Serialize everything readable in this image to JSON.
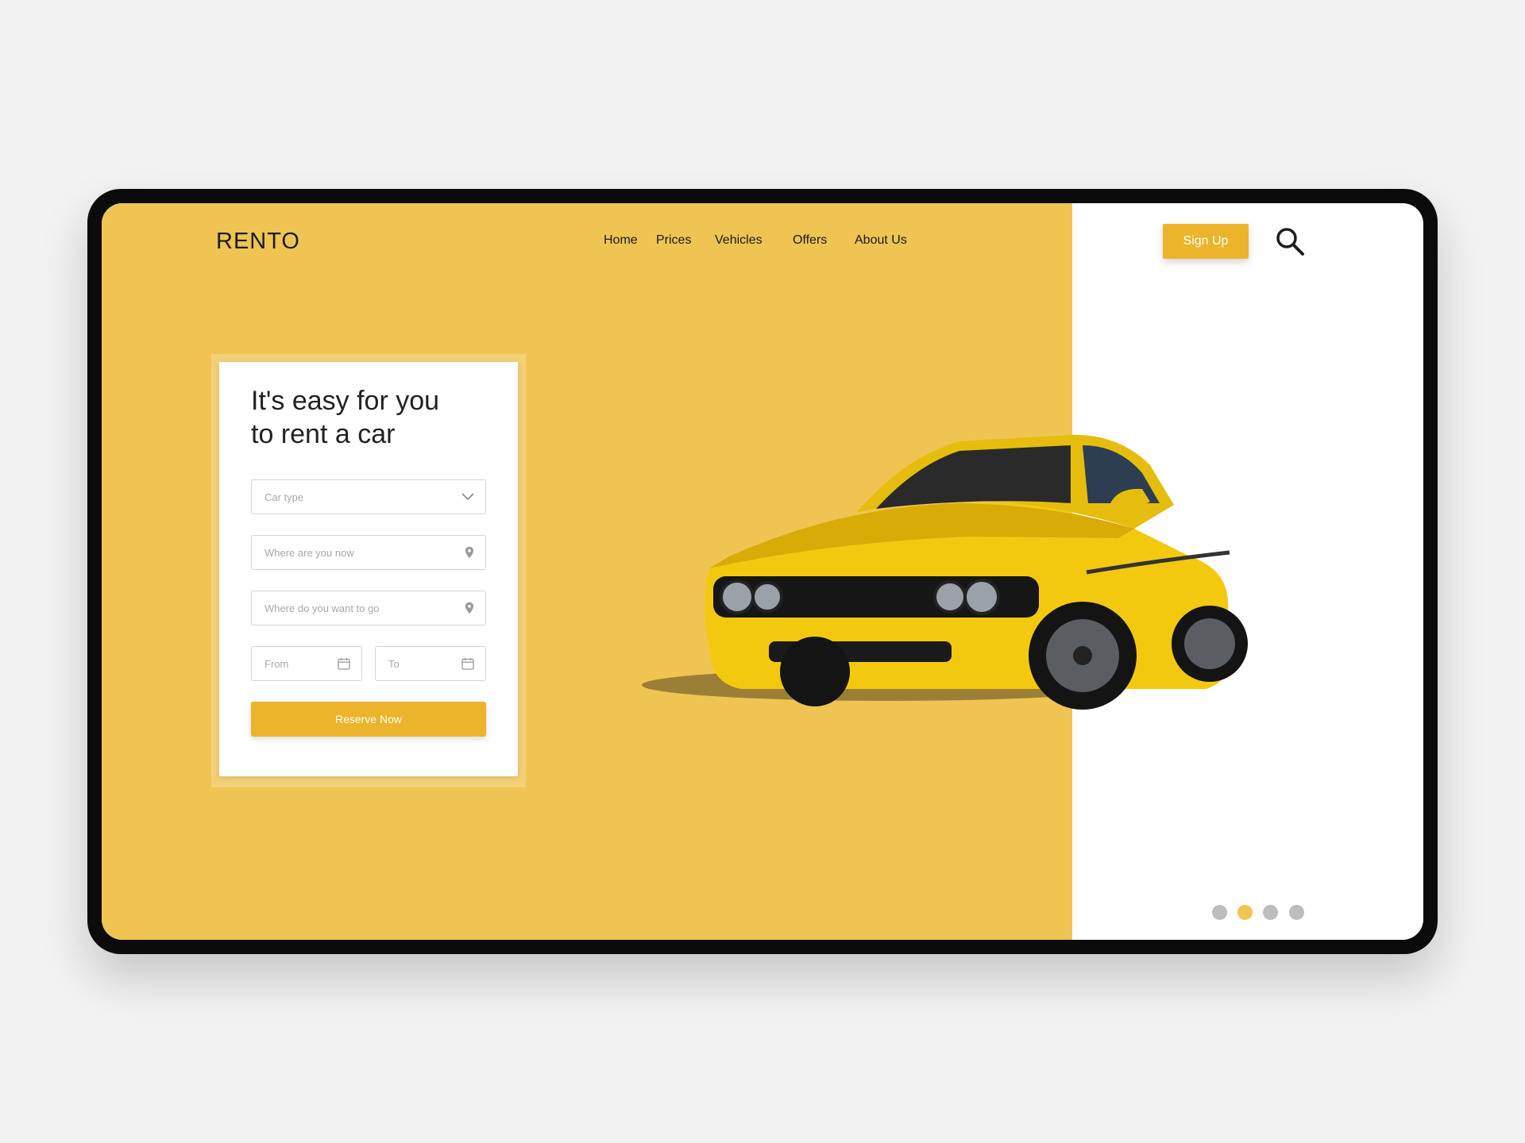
{
  "brand": {
    "logo": "RENTO"
  },
  "nav": {
    "items": [
      {
        "label": "Home"
      },
      {
        "label": "Prices"
      },
      {
        "label": "Vehicles"
      },
      {
        "label": "Offers"
      },
      {
        "label": "About Us"
      }
    ]
  },
  "header": {
    "signup_label": "Sign Up",
    "search_icon": "search-icon"
  },
  "hero": {
    "title_line1": "It's easy for you",
    "title_line2": "to rent a car"
  },
  "form": {
    "car_type_placeholder": "Car type",
    "location_now_placeholder": "Where are you now",
    "destination_placeholder": "Where do you want to go",
    "from_placeholder": "From",
    "to_placeholder": "To",
    "reserve_label": "Reserve Now"
  },
  "carousel": {
    "count": 4,
    "active_index": 1
  },
  "colors": {
    "accent": "#ecb42a",
    "hero_background": "#f0c453",
    "device_frame": "#0b0b0b",
    "page_background": "#f2f2f2"
  }
}
